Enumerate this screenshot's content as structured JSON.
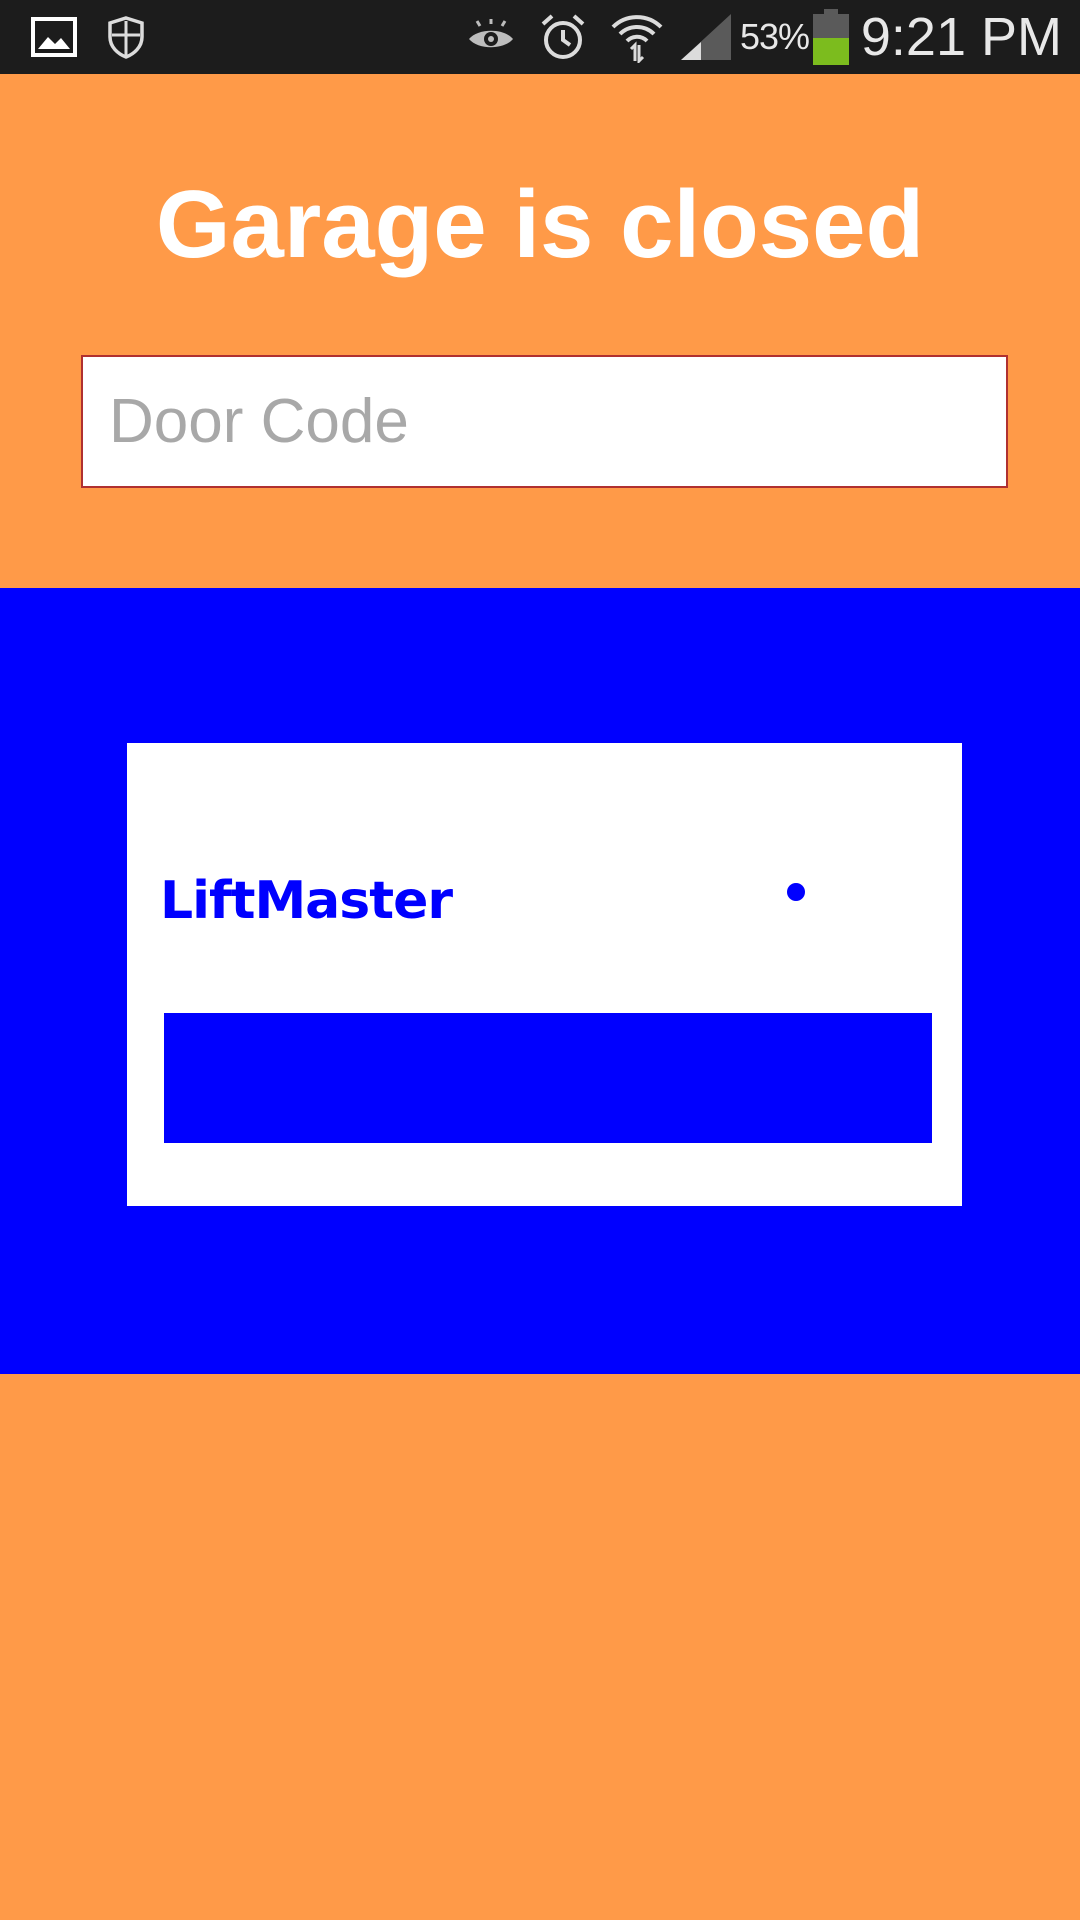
{
  "status_bar": {
    "left_icons": [
      "gallery-icon",
      "shield-icon"
    ],
    "right_icons": [
      "eye-icon",
      "alarm-icon",
      "wifi-icon",
      "signal-icon",
      "battery-icon"
    ],
    "battery_percent": "53%",
    "battery_level": 0.53,
    "time": "9:21 PM"
  },
  "main": {
    "title": "Garage is closed",
    "door_code": {
      "placeholder": "Door Code",
      "value": ""
    },
    "opener": {
      "brand": "LiftMaster"
    }
  },
  "colors": {
    "background": "#FF9A48",
    "panel": "#0000FF",
    "status_bar": "#1C1C1C",
    "input_border": "#B03030"
  }
}
